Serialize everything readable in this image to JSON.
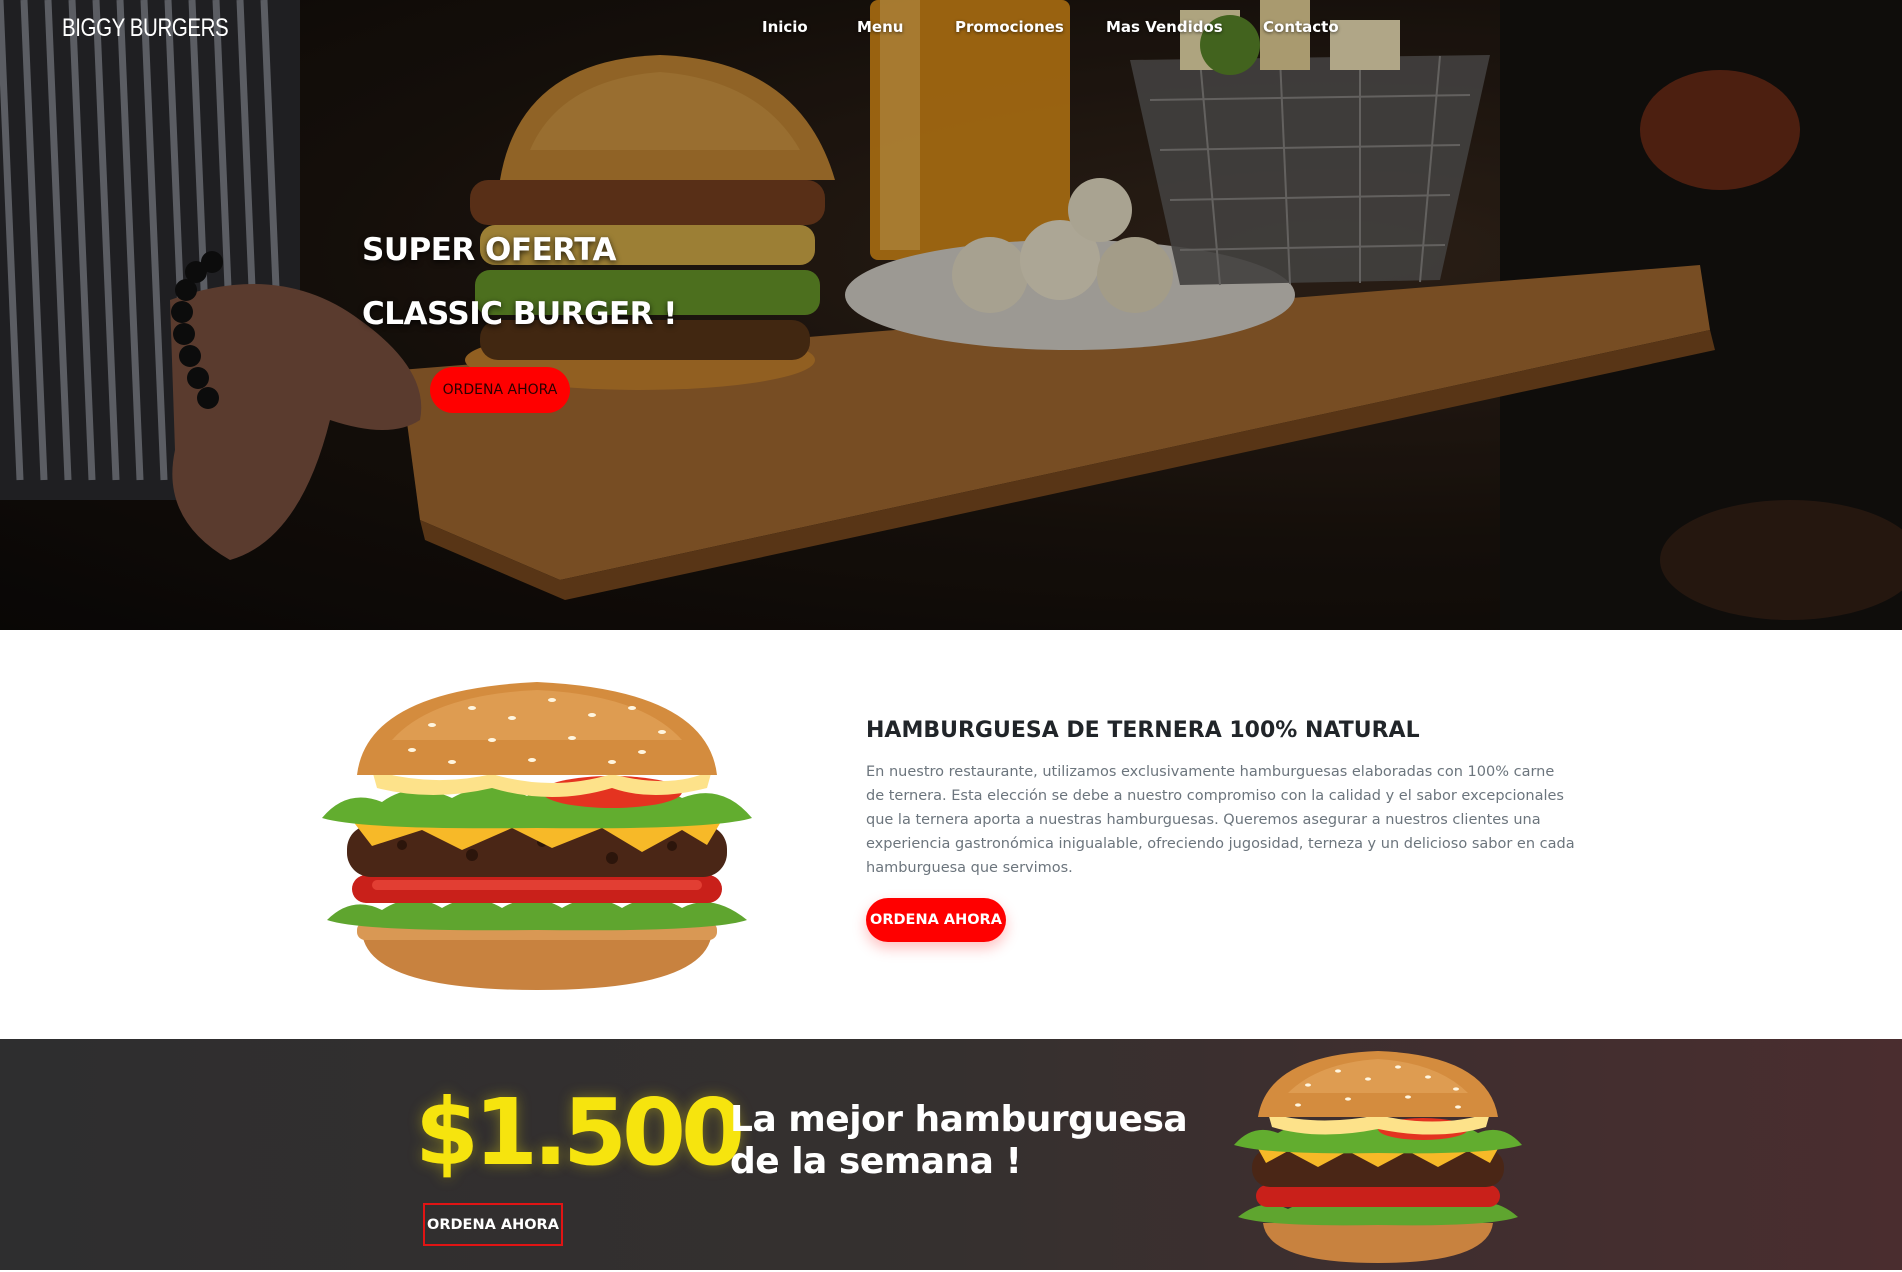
{
  "brand": "BIGGY BURGERS",
  "nav": {
    "items": [
      "Inicio",
      "Menu",
      "Promociones",
      "Mas Vendidos",
      "Contacto"
    ]
  },
  "hero": {
    "title_line1": "SUPER OFERTA",
    "title_line2": "CLASSIC BURGER !",
    "cta_label": "ORDENA AHORA"
  },
  "feature": {
    "title": "HAMBURGUESA DE TERNERA 100% NATURAL",
    "text": "En nuestro restaurante, utilizamos exclusivamente hamburguesas elaboradas con 100% carne de ternera. Esta elección se debe a nuestro compromiso con la calidad y el sabor excepcionales que la ternera aporta a nuestras hamburguesas. Queremos asegurar a nuestros clientes una experiencia gastronómica inigualable, ofreciendo jugosidad, terneza y un delicioso sabor en cada hamburguesa que servimos.",
    "cta_label": "ORDENA AHORA"
  },
  "promo": {
    "price": "$1.500",
    "line1": "La mejor hamburguesa",
    "line2": "de la semana !",
    "cta_label": "ORDENA AHORA"
  },
  "colors": {
    "accent_red": "#ff0000",
    "price_yellow": "#f6e40e",
    "promo_bg": "#35302f",
    "heading_dark": "#212529",
    "body_gray": "#6c757d"
  }
}
